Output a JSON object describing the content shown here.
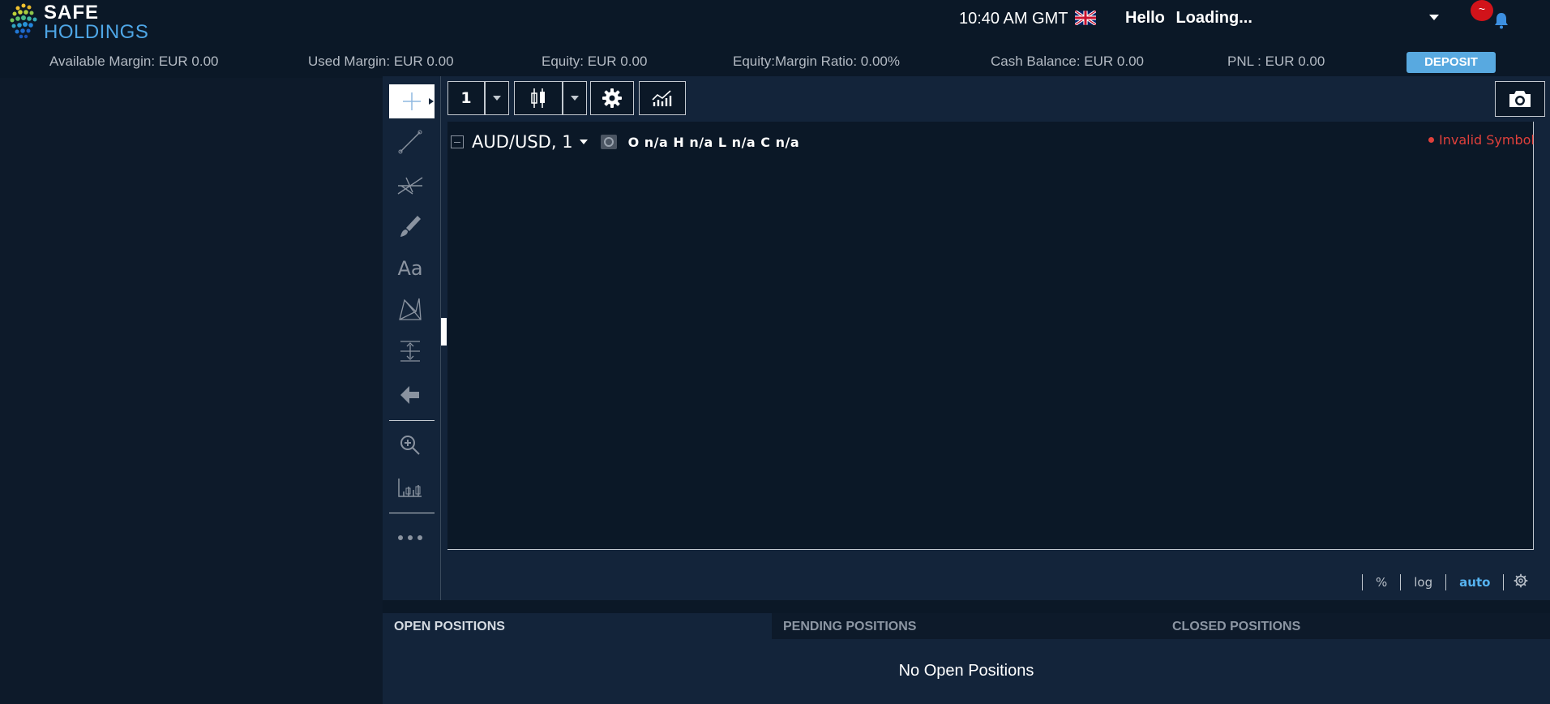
{
  "brand": {
    "line1": "SAFE",
    "line2": "HOLDINGS"
  },
  "header": {
    "clock": "10:40 AM GMT",
    "greeting": "Hello",
    "user_name": "Loading...",
    "notification_badge": "~",
    "language_flag": "uk-flag-icon"
  },
  "account": {
    "available_margin": "Available Margin: EUR 0.00",
    "used_margin": "Used Margin: EUR  0.00",
    "equity": "Equity: EUR  0.00",
    "equity_margin_ratio": "Equity:Margin Ratio: 0.00%",
    "cash_balance": "Cash Balance: EUR 0.00",
    "pnl": "PNL : EUR  0.00",
    "deposit_label": "DEPOSIT"
  },
  "chart_toolbar": {
    "interval": "1"
  },
  "chart": {
    "symbol": "AUD/USD, 1",
    "ohlc": "O n/a H n/a L n/a C n/a",
    "status": "Invalid Symbol",
    "scale_options": {
      "percent": "%",
      "log": "log",
      "auto": "auto"
    }
  },
  "drawing_tools": {
    "text_tool_label": "Aa"
  },
  "positions": {
    "tabs": [
      {
        "label": "OPEN POSITIONS"
      },
      {
        "label": "PENDING POSITIONS"
      },
      {
        "label": "CLOSED POSITIONS"
      }
    ],
    "empty_message": "No Open Positions"
  },
  "colors": {
    "background": "#0b1827",
    "panel": "#13243a",
    "accent": "#58a9e0",
    "error": "#e0403b",
    "badge": "#d1131a"
  }
}
